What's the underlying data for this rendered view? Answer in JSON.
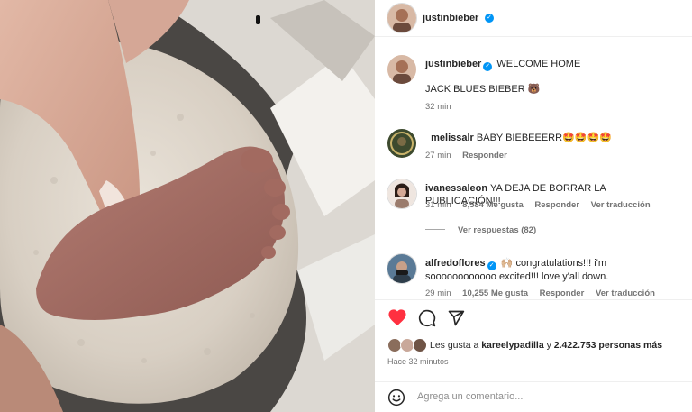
{
  "post": {
    "author": "justinbieber",
    "caption_line1": "WELCOME HOME",
    "caption_line2": "JACK BLUES BIEBER 🐻",
    "caption_time": "32 min"
  },
  "comments": [
    {
      "user": "_melissalr",
      "text": "BABY BIEBEEERR🤩🤩🤩🤩",
      "time": "27 min",
      "likes": "",
      "reply": "Responder",
      "translate": ""
    },
    {
      "user": "ivanessaleon",
      "text": "YA DEJA DE BORRAR LA PUBLICACIÓN!!!",
      "time": "31 min",
      "likes": "8,584 Me gusta",
      "reply": "Responder",
      "translate": "Ver traducción",
      "view_replies": "Ver respuestas (82)"
    },
    {
      "user": "alfredoflores",
      "text": "🙌🏼 congratulations!!! i'm soooooooooooo excited!!! love y'all down.",
      "time": "29 min",
      "likes": "10,255 Me gusta",
      "reply": "Responder",
      "translate": "Ver traducción"
    }
  ],
  "actions": {
    "like_icon": "heart-filled-icon",
    "comment_icon": "comment-icon",
    "share_icon": "share-icon"
  },
  "likes": {
    "prefix": "Les gusta a ",
    "user": "kareelypadilla",
    "middle": " y ",
    "count": "2.422.753",
    "suffix": " personas más"
  },
  "posted_ago": "Hace 32 minutos",
  "add_comment": {
    "placeholder": "Agrega un comentario..."
  },
  "colors": {
    "like_red": "#ff3040",
    "verified_blue": "#0095f6",
    "muted": "#737373"
  }
}
